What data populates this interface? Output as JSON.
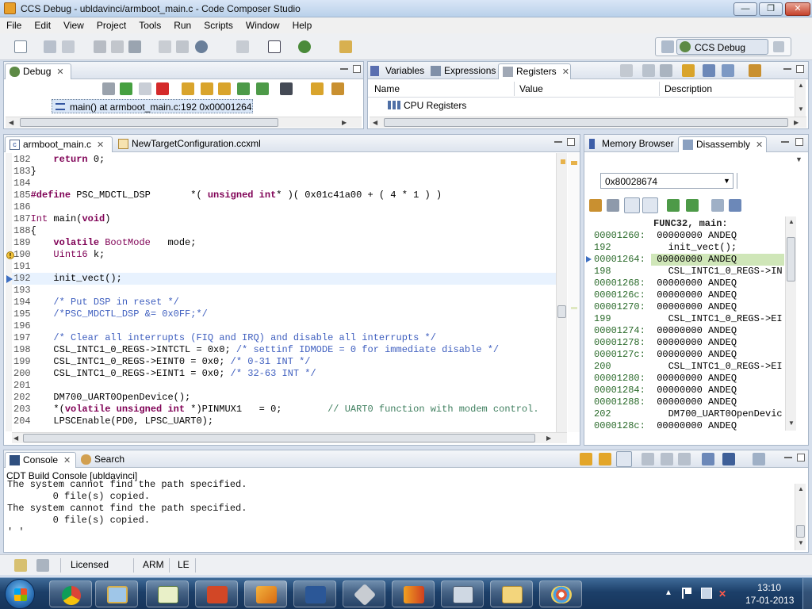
{
  "window": {
    "title": "CCS Debug - ubldavinci/armboot_main.c - Code Composer Studio"
  },
  "menu": [
    "File",
    "Edit",
    "View",
    "Project",
    "Tools",
    "Run",
    "Scripts",
    "Window",
    "Help"
  ],
  "perspective": {
    "label": "CCS Debug"
  },
  "debug_view": {
    "tab": "Debug",
    "frame": "main() at armboot_main.c:192 0x00001264"
  },
  "registers_view": {
    "tabs": [
      "Variables",
      "Expressions",
      "Registers"
    ],
    "columns": [
      "Name",
      "Value",
      "Description"
    ],
    "rows": [
      {
        "name": "CPU Registers",
        "value": "",
        "description": ""
      }
    ]
  },
  "editor": {
    "tabs": [
      "armboot_main.c",
      "NewTargetConfiguration.ccxml"
    ],
    "lines": [
      {
        "n": "182",
        "t": "    return 0;"
      },
      {
        "n": "183",
        "t": "}"
      },
      {
        "n": "184",
        "t": ""
      },
      {
        "n": "185",
        "t": "#define PSC_MDCTL_DSP       *( unsigned int* )( 0x01c41a00 + ( 4 * 1 ) )"
      },
      {
        "n": "186",
        "t": ""
      },
      {
        "n": "187",
        "t": "Int main(void)"
      },
      {
        "n": "188",
        "t": "{"
      },
      {
        "n": "189",
        "t": "    volatile BootMode   mode;"
      },
      {
        "n": "190",
        "t": "    Uint16 k;"
      },
      {
        "n": "191",
        "t": ""
      },
      {
        "n": "192",
        "t": "    init_vect();"
      },
      {
        "n": "193",
        "t": ""
      },
      {
        "n": "194",
        "t": "    /* Put DSP in reset */"
      },
      {
        "n": "195",
        "t": "    /*PSC_MDCTL_DSP &= 0x0FF;*/"
      },
      {
        "n": "196",
        "t": ""
      },
      {
        "n": "197",
        "t": "    /* Clear all interrupts (FIQ and IRQ) and disable all interrupts */"
      },
      {
        "n": "198",
        "t": "    CSL_INTC1_0_REGS->INTCTL = 0x0; /* settinf IDMODE = 0 for immediate disable */"
      },
      {
        "n": "199",
        "t": "    CSL_INTC1_0_REGS->EINT0 = 0x0; /* 0-31 INT */"
      },
      {
        "n": "200",
        "t": "    CSL_INTC1_0_REGS->EINT1 = 0x0; /* 32-63 INT */"
      },
      {
        "n": "201",
        "t": ""
      },
      {
        "n": "202",
        "t": "    DM700_UART0OpenDevice();"
      },
      {
        "n": "203",
        "t": "    *(volatile unsigned int *)PINMUX1   = 0;        // UART0 function with modem control."
      },
      {
        "n": "204",
        "t": "    LPSCEnable(PD0, LPSC_UART0);"
      }
    ]
  },
  "disassembly": {
    "tabs": [
      "Memory Browser",
      "Disassembly"
    ],
    "address": "0x80028674",
    "header": "FUNC32, main:",
    "rows": [
      {
        "a": "00001260:",
        "c": " 00000000 ANDEQ"
      },
      {
        "a": "192",
        "c": "   init_vect();"
      },
      {
        "a": "00001264:",
        "c": " 00000000 ANDEQ"
      },
      {
        "a": "198",
        "c": "   CSL_INTC1_0_REGS->IN"
      },
      {
        "a": "00001268:",
        "c": " 00000000 ANDEQ"
      },
      {
        "a": "0000126c:",
        "c": " 00000000 ANDEQ"
      },
      {
        "a": "00001270:",
        "c": " 00000000 ANDEQ"
      },
      {
        "a": "199",
        "c": "   CSL_INTC1_0_REGS->EI"
      },
      {
        "a": "00001274:",
        "c": " 00000000 ANDEQ"
      },
      {
        "a": "00001278:",
        "c": " 00000000 ANDEQ"
      },
      {
        "a": "0000127c:",
        "c": " 00000000 ANDEQ"
      },
      {
        "a": "200",
        "c": "   CSL_INTC1_0_REGS->EI"
      },
      {
        "a": "00001280:",
        "c": " 00000000 ANDEQ"
      },
      {
        "a": "00001284:",
        "c": " 00000000 ANDEQ"
      },
      {
        "a": "00001288:",
        "c": " 00000000 ANDEQ"
      },
      {
        "a": "202",
        "c": "   DM700_UART0OpenDevic"
      },
      {
        "a": "0000128c:",
        "c": " 00000000 ANDEQ"
      }
    ]
  },
  "console": {
    "tabs": [
      "Console",
      "Search"
    ],
    "title": "CDT Build Console [ubldavinci]",
    "lines": [
      "The system cannot find the path specified.",
      "        0 file(s) copied.",
      "The system cannot find the path specified.",
      "        0 file(s) copied.",
      "' '"
    ]
  },
  "statusbar": {
    "license": "Licensed",
    "arch": "ARM",
    "endian": "LE"
  },
  "taskbar": {
    "time": "13:10",
    "date": "17-01-2013"
  }
}
